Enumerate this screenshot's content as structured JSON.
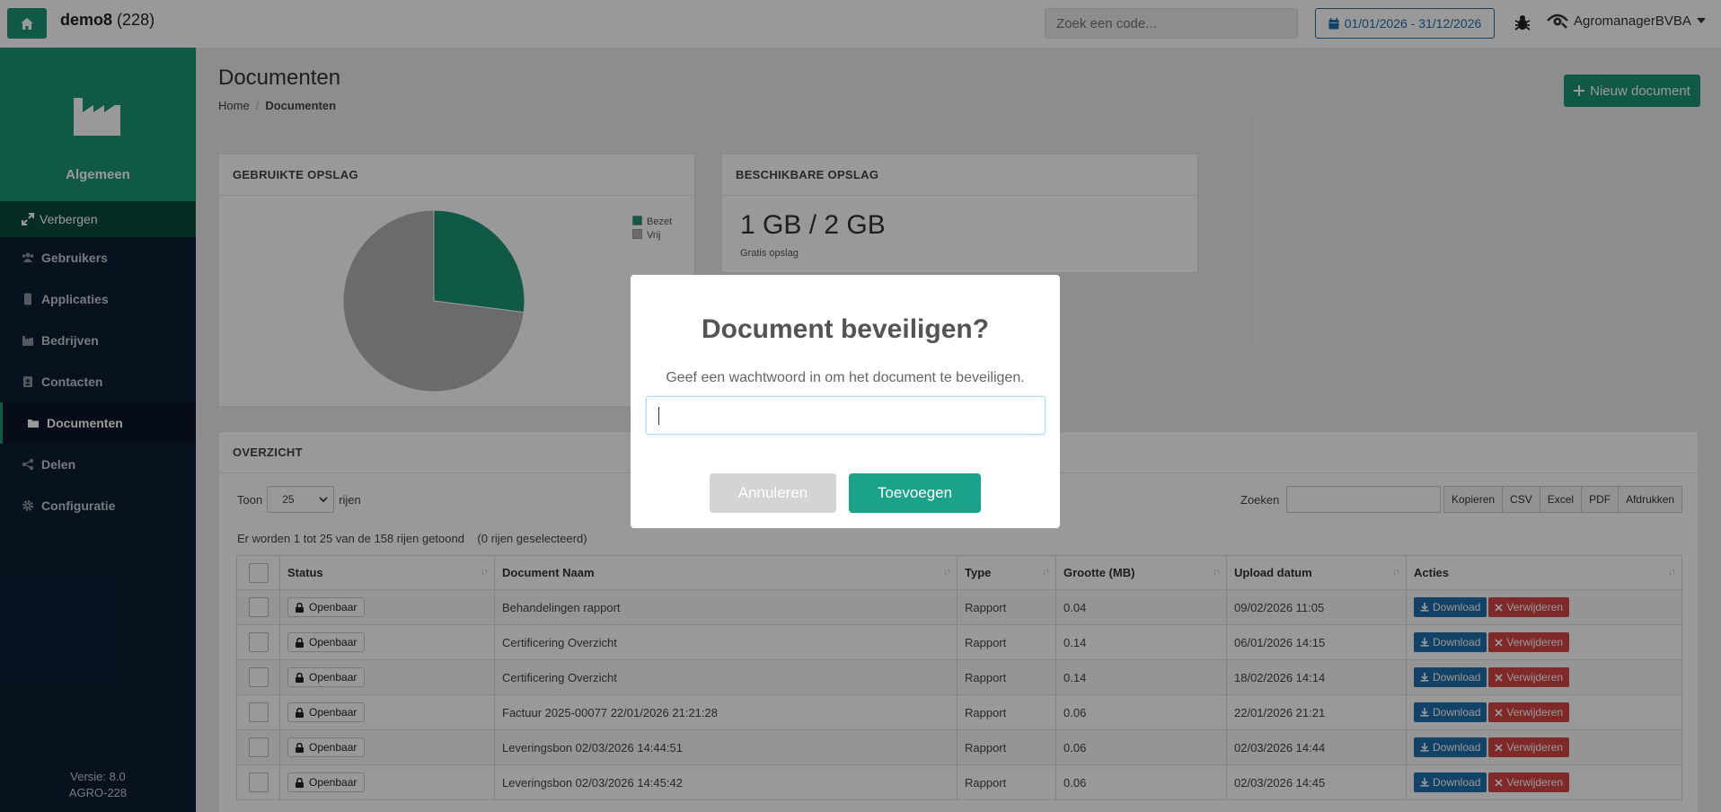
{
  "topbar": {
    "app_name": "demo8",
    "app_count": "(228)",
    "search_placeholder": "Zoek een code...",
    "date_range": "01/01/2026 - 31/12/2026",
    "user_name": "AgromanagerBVBA"
  },
  "sidebar": {
    "title": "Algemeen",
    "hide_label": "Verbergen",
    "items": [
      {
        "label": "Gebruikers"
      },
      {
        "label": "Applicaties"
      },
      {
        "label": "Bedrijven"
      },
      {
        "label": "Contacten"
      },
      {
        "label": "Documenten"
      },
      {
        "label": "Delen"
      },
      {
        "label": "Configuratie"
      }
    ],
    "version": "Versie: 8.0",
    "build": "AGRO-228"
  },
  "header": {
    "title": "Documenten",
    "breadcrumb_home": "Home",
    "breadcrumb_current": "Documenten",
    "new_button": "Nieuw document"
  },
  "storage_used": {
    "title": "GEBRUIKTE OPSLAG",
    "legend": [
      "Bezet",
      "Vrij"
    ],
    "colors": [
      "#1a9475",
      "#b3b3b3"
    ]
  },
  "chart_data": {
    "type": "pie",
    "categories": [
      "Bezet",
      "Vrij"
    ],
    "values": [
      27,
      73
    ],
    "title": "",
    "legend": "top-right"
  },
  "storage_available": {
    "title": "BESCHIKBARE OPSLAG",
    "value": "1 GB / 2 GB",
    "subtext": "Gratis opslag"
  },
  "overview": {
    "title": "OVERZICHT",
    "show_label": "Toon",
    "page_length": "25",
    "rows_label": "rijen",
    "search_label": "Zoeken",
    "export_buttons": [
      "Kopieren",
      "CSV",
      "Excel",
      "PDF",
      "Afdrukken"
    ],
    "info": "Er worden 1 tot 25 van de 158 rijen getoond",
    "selected_info": "(0 rijen geselecteerd)",
    "columns": [
      "Status",
      "Document Naam",
      "Type",
      "Grootte (MB)",
      "Upload datum",
      "Acties"
    ],
    "download_label": "Download",
    "delete_label": "Verwijderen",
    "rows": [
      {
        "status": "Openbaar",
        "name": "Behandelingen rapport",
        "type": "Rapport",
        "size": "0.04",
        "date": "09/02/2026 11:05"
      },
      {
        "status": "Openbaar",
        "name": "Certificering Overzicht",
        "type": "Rapport",
        "size": "0.14",
        "date": "06/01/2026 14:15"
      },
      {
        "status": "Openbaar",
        "name": "Certificering Overzicht",
        "type": "Rapport",
        "size": "0.14",
        "date": "18/02/2026 14:14"
      },
      {
        "status": "Openbaar",
        "name": "Factuur 2025-00077 22/01/2026 21:21:28",
        "type": "Rapport",
        "size": "0.06",
        "date": "22/01/2026 21:21"
      },
      {
        "status": "Openbaar",
        "name": "Leveringsbon 02/03/2026 14:44:51",
        "type": "Rapport",
        "size": "0.06",
        "date": "02/03/2026 14:44"
      },
      {
        "status": "Openbaar",
        "name": "Leveringsbon 02/03/2026 14:45:42",
        "type": "Rapport",
        "size": "0.06",
        "date": "02/03/2026 14:45"
      }
    ]
  },
  "modal": {
    "title": "Document beveiligen?",
    "text": "Geef een wachtwoord in om het document te beveiligen.",
    "input_value": "",
    "cancel_label": "Annuleren",
    "confirm_label": "Toevoegen"
  }
}
